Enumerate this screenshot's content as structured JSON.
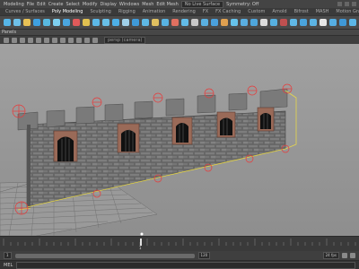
{
  "menubar": {
    "items": [
      "Modeling",
      "File",
      "Edit",
      "Create",
      "Select",
      "Modify",
      "Display",
      "Windows",
      "Mesh",
      "Edit Mesh"
    ],
    "field": "No Live Surface",
    "symmetry": "Symmetry: Off"
  },
  "shelf_tabs": [
    "Curves / Surfaces",
    "Poly Modeling",
    "Sculpting",
    "Rigging",
    "Animation",
    "Rendering",
    "FX",
    "FX Caching",
    "Custom",
    "Arnold",
    "Bifrost",
    "MASH",
    "Motion Graphics",
    "XGen"
  ],
  "shelf_icon_colors": [
    "#56b6e8",
    "#6ec0e8",
    "#e8c155",
    "#3ea0e0",
    "#58b9e0",
    "#7ed0f0",
    "#4aa6e0",
    "#e05a5a",
    "#e0c050",
    "#5cb8e8",
    "#68c0e8",
    "#4dafe6",
    "#a0d0e8",
    "#3f9ad8",
    "#5eb8e4",
    "#e0c060",
    "#58b3e2",
    "#e07060",
    "#62bce8",
    "#c8c8c8",
    "#5ab0e0",
    "#4aa0dc",
    "#e0a050",
    "#66c2ea",
    "#5aaee0",
    "#4ea6dc",
    "#dcdcdc",
    "#56b0e0",
    "#c05050",
    "#60b8e6",
    "#4aa4dc",
    "#5cb4e4",
    "#e8e8e8",
    "#56aee2",
    "#3f98d6",
    "#5cb6e6"
  ],
  "panel_menu": "Panels",
  "camera_field": "persp (camera)",
  "timeline": {
    "current_frame": "1"
  },
  "range": {
    "start": "1",
    "end": "120",
    "fps": "24 fps"
  },
  "command_line": {
    "mel_label": "MEL"
  }
}
